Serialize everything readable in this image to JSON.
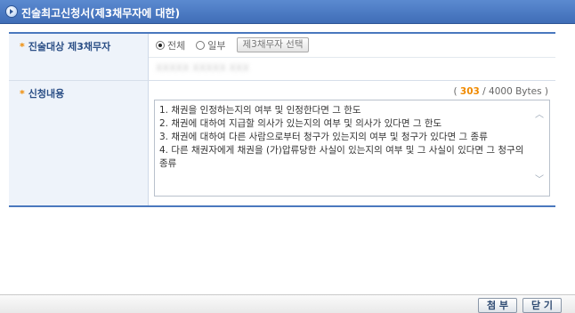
{
  "window": {
    "title": "진술최고신청서(제3채무자에 대한)"
  },
  "form": {
    "debtor_row": {
      "label": "진술대상 제3채무자",
      "options": [
        {
          "label": "전체",
          "selected": true
        },
        {
          "label": "일부",
          "selected": false
        }
      ],
      "select_button_label": "제3채무자 선택",
      "blurred_value": "XXXXX XXXXX XXX"
    },
    "content_row": {
      "label": "신청내용",
      "counter": {
        "open": "( ",
        "current": "303",
        "separator": " / ",
        "max": "4000 Bytes",
        "close": " )"
      },
      "lines": [
        "1. 채권을 인정하는지의 여부 및 인정한다면 그 한도",
        "2. 채권에 대하여 지급할 의사가 있는지의 여부 및 의사가 있다면 그 한도",
        "3. 채권에 대하여 다른 사람으로부터 청구가 있는지의 여부 및 청구가 있다면 그 종류",
        "4. 다른 채권자에게 채권을 (가)압류당한 사실이 있는지의 여부 및 그 사실이 있다면 그 청구의 종류"
      ]
    }
  },
  "footer": {
    "attach_label": "첨 부",
    "close_label": "닫 기"
  }
}
